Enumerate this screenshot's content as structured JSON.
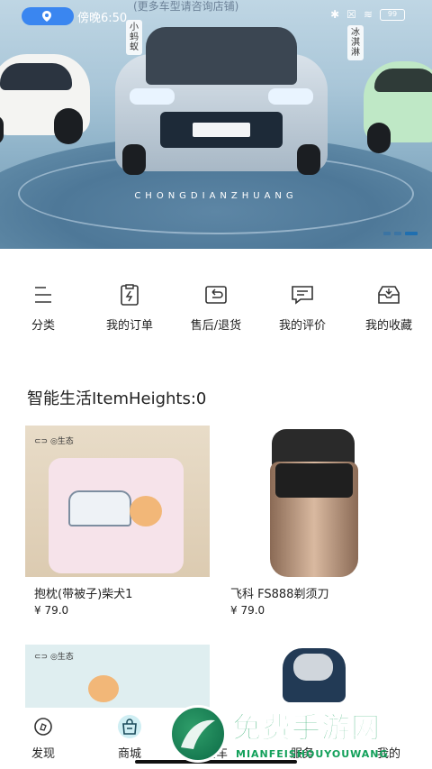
{
  "status_bar": {
    "time": "傍晚6:50",
    "battery": "99"
  },
  "banner": {
    "tagline": "(更多车型请咨询店铺)",
    "brand_text": "CHONGDIANZHUANG",
    "tag_left": "小蚂蚁",
    "tag_right": "冰淇淋",
    "slide_count": 3,
    "active_slide": 3
  },
  "quick_menu": [
    {
      "label": "分类",
      "icon": "list-icon"
    },
    {
      "label": "我的订单",
      "icon": "order-icon"
    },
    {
      "label": "售后/退货",
      "icon": "return-icon"
    },
    {
      "label": "我的评价",
      "icon": "comment-icon"
    },
    {
      "label": "我的收藏",
      "icon": "favorite-icon"
    }
  ],
  "section": {
    "title": "智能生活ItemHeights:0"
  },
  "products": [
    {
      "name": "抱枕(带被子)柴犬1",
      "price": "¥ 79.0"
    },
    {
      "name": "飞科 FS888剃须刀",
      "price": "¥ 79.0"
    },
    {
      "name": "",
      "price": ""
    },
    {
      "name": "",
      "price": ""
    }
  ],
  "tabbar": [
    {
      "label": "发现",
      "icon": "discover-icon"
    },
    {
      "label": "商城",
      "icon": "shop-icon",
      "active": true
    },
    {
      "label": "爱车",
      "icon": "car-icon"
    },
    {
      "label": "服务",
      "icon": "service-icon"
    },
    {
      "label": "我的",
      "icon": "profile-icon"
    }
  ],
  "watermark": {
    "title": "免费手游网",
    "subtitle": "MIANFEISHOUYOUWANG"
  },
  "colors": {
    "accent_blue": "#3a86f0",
    "watermark_green": "#12a05a"
  }
}
